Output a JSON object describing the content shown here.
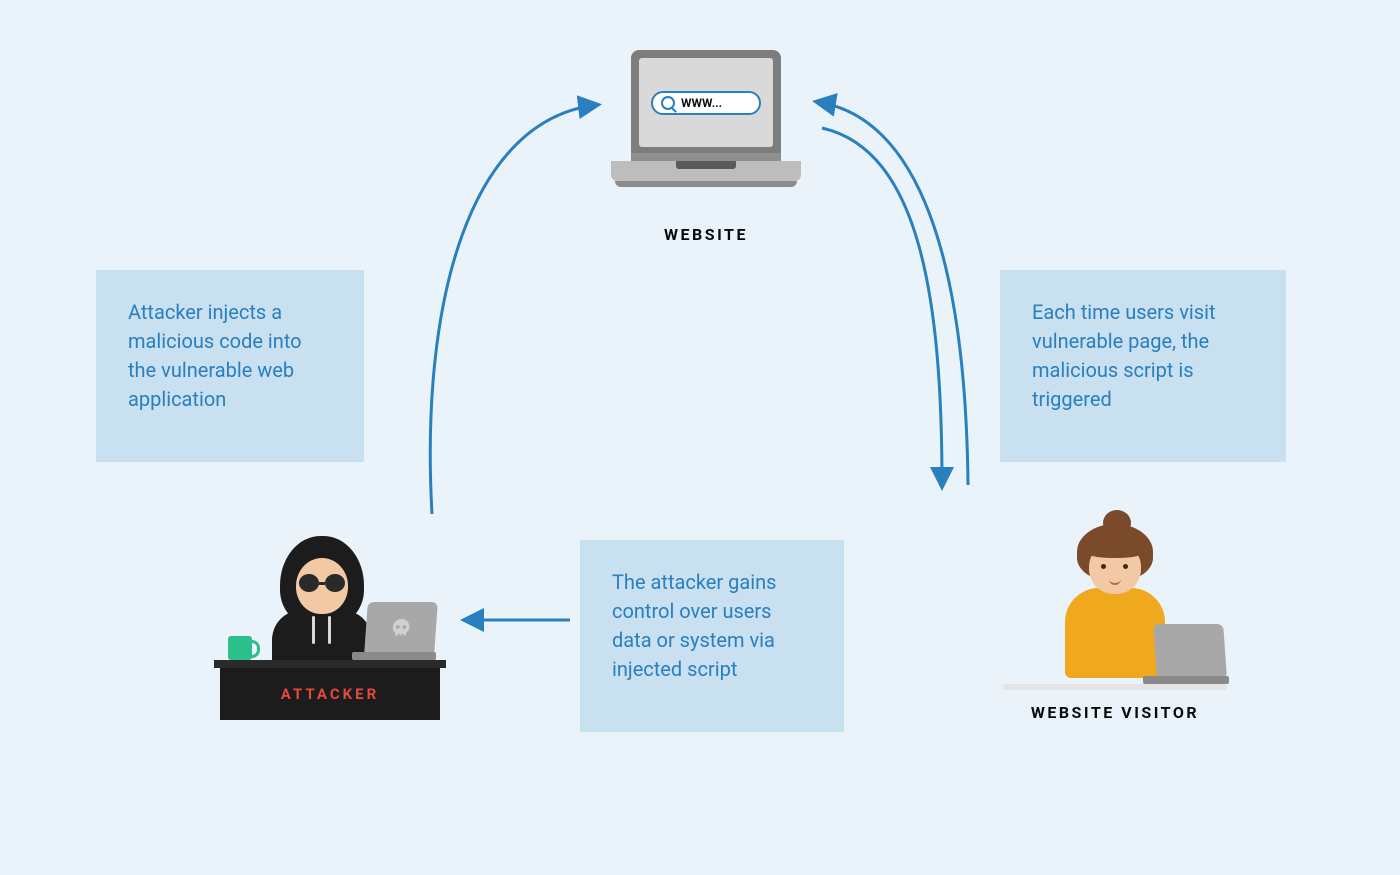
{
  "nodes": {
    "website": {
      "label": "WEBSITE",
      "url_text": "WWW..."
    },
    "attacker": {
      "label": "ATTACKER"
    },
    "visitor": {
      "label": "WEBSITE VISITOR"
    }
  },
  "boxes": {
    "left": "Attacker injects a malicious code into the vulnerable web application",
    "right": "Each time users visit vulnerable page, the malicious script is triggered",
    "center": "The attacker gains control over users data or system via injected script"
  }
}
